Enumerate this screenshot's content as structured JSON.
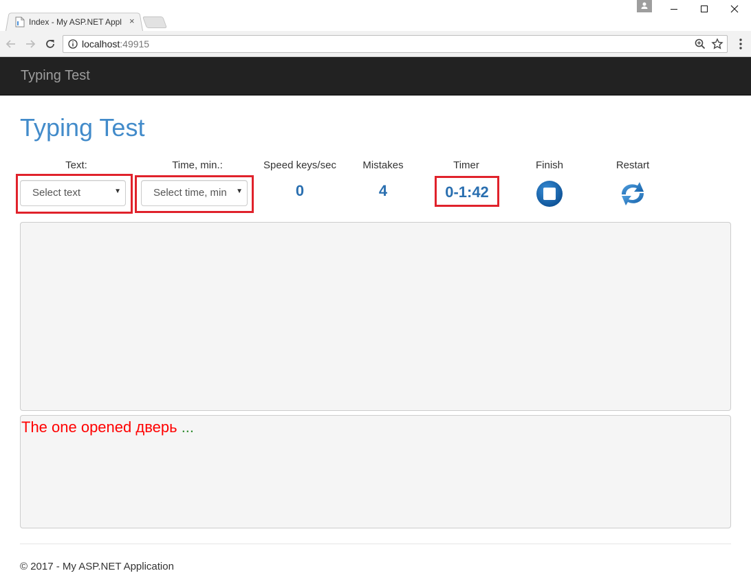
{
  "browser": {
    "tab_title": "Index - My ASP.NET Application",
    "tab_close": "×",
    "url_host": "localhost",
    "url_port": ":49915"
  },
  "navbar": {
    "brand": "Typing Test"
  },
  "page": {
    "title": "Typing Test"
  },
  "controls": {
    "text_label": "Text:",
    "text_select_value": "Select text",
    "time_label": "Time, min.:",
    "time_select_value": "Select time, min",
    "speed_label": "Speed keys/sec",
    "speed_value": "0",
    "mistakes_label": "Mistakes",
    "mistakes_value": "4",
    "timer_label": "Timer",
    "timer_value": "0-1:42",
    "finish_label": "Finish",
    "restart_label": "Restart"
  },
  "text_panel": {
    "typed": "The one opened дверь",
    "ellipsis": " ..."
  },
  "footer": {
    "text": "© 2017 - My ASP.NET Application"
  },
  "colors": {
    "accent": "#428bca",
    "stat_blue": "#2a6fb0",
    "highlight_red": "#e0222b",
    "navbar_bg": "#222222"
  },
  "icons": {
    "finish": "stop-circle-icon",
    "restart": "refresh-arrows-icon"
  }
}
